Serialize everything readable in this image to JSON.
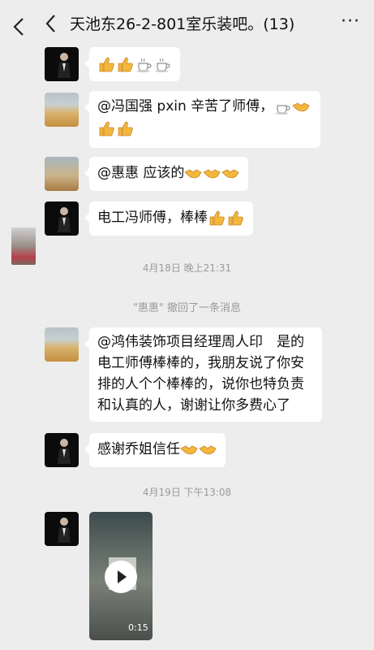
{
  "header": {
    "title": "天池东26-2-801室乐装吧。(13)",
    "more_label": "···"
  },
  "messages": [
    {
      "text": ""
    },
    {
      "line1": "@冯国强  pxin 辛苦了师傅，",
      "line2": ""
    },
    {
      "text": "@惠惠  应该的"
    },
    {
      "text": "电工冯师傅，棒棒"
    },
    {
      "lines": [
        "@鸿伟装饰项目经理周人印　是的",
        "电工师傅棒棒的，我朋友说了你安",
        "排的人个个棒棒的，说你也特负责",
        "和认真的人，谢谢让你多费心了"
      ]
    },
    {
      "text": "感谢乔姐信任"
    }
  ],
  "timestamps": [
    "4月18日 晚上21:31",
    "4月19日 下午13:08"
  ],
  "recall_notice": "\"惠惠\" 撤回了一条消息",
  "video": {
    "duration": "0:15"
  },
  "emoji_names": [
    "thumbs-up-emoji",
    "coffee-emoji",
    "handshake-emoji"
  ]
}
